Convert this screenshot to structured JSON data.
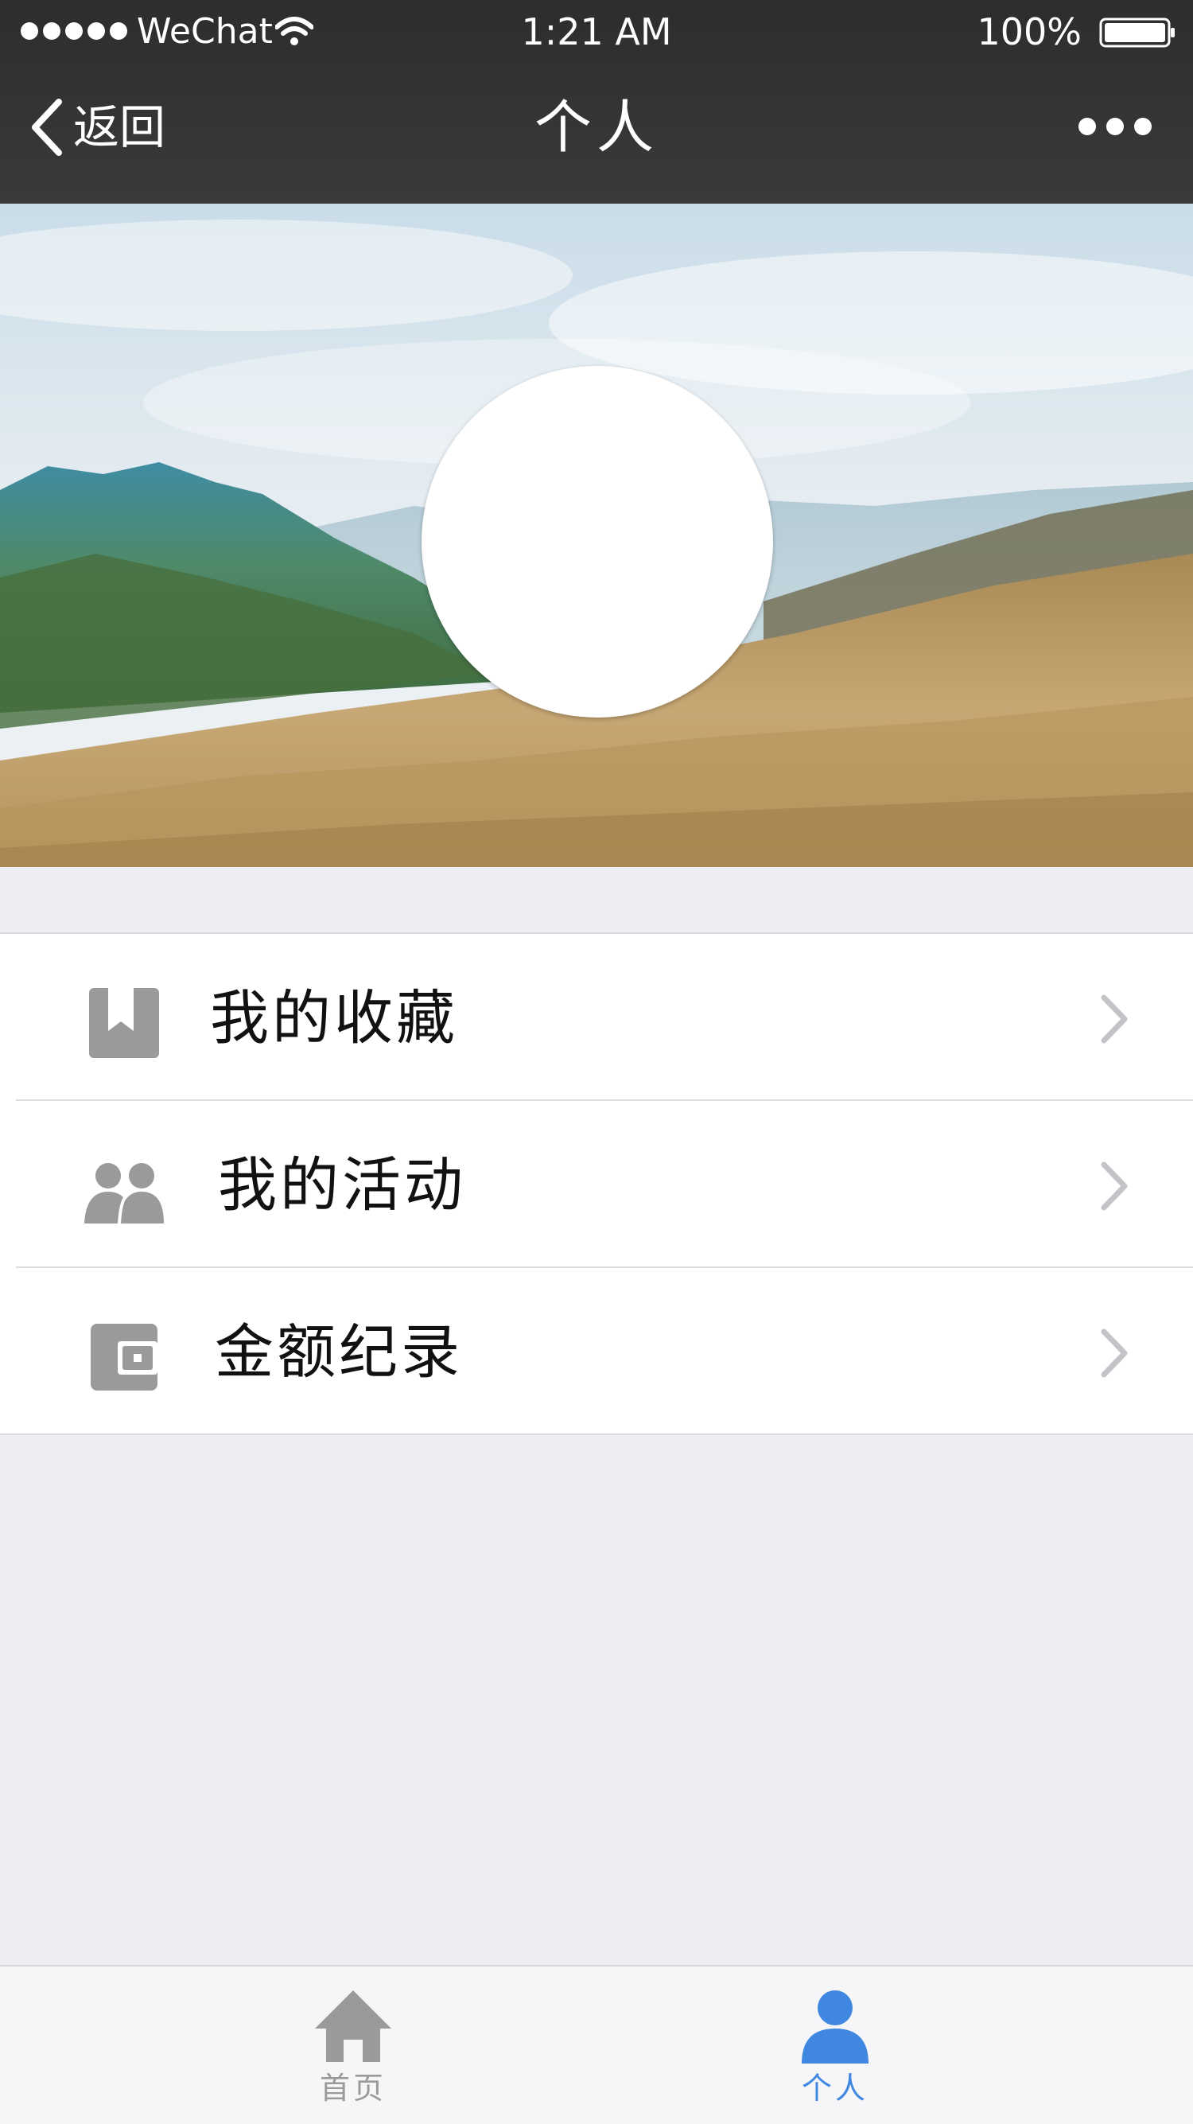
{
  "status_bar": {
    "carrier": "WeChat",
    "time": "1:21 AM",
    "battery": "100%"
  },
  "nav": {
    "back_label": "返回",
    "title": "个人"
  },
  "menu": {
    "items": [
      {
        "label": "我的收藏",
        "icon": "bookmark-icon"
      },
      {
        "label": "我的活动",
        "icon": "people-icon"
      },
      {
        "label": "金额纪录",
        "icon": "wallet-icon"
      }
    ]
  },
  "tabbar": {
    "items": [
      {
        "label": "首页",
        "icon": "home-icon",
        "active": false
      },
      {
        "label": "个人",
        "icon": "person-icon",
        "active": true
      }
    ]
  },
  "colors": {
    "nav_bg": "#333335",
    "page_bg": "#eeeef2",
    "icon_gray": "#9a9a9a",
    "chevron_gray": "#c4c4c8",
    "active_blue": "#3f87e0"
  }
}
